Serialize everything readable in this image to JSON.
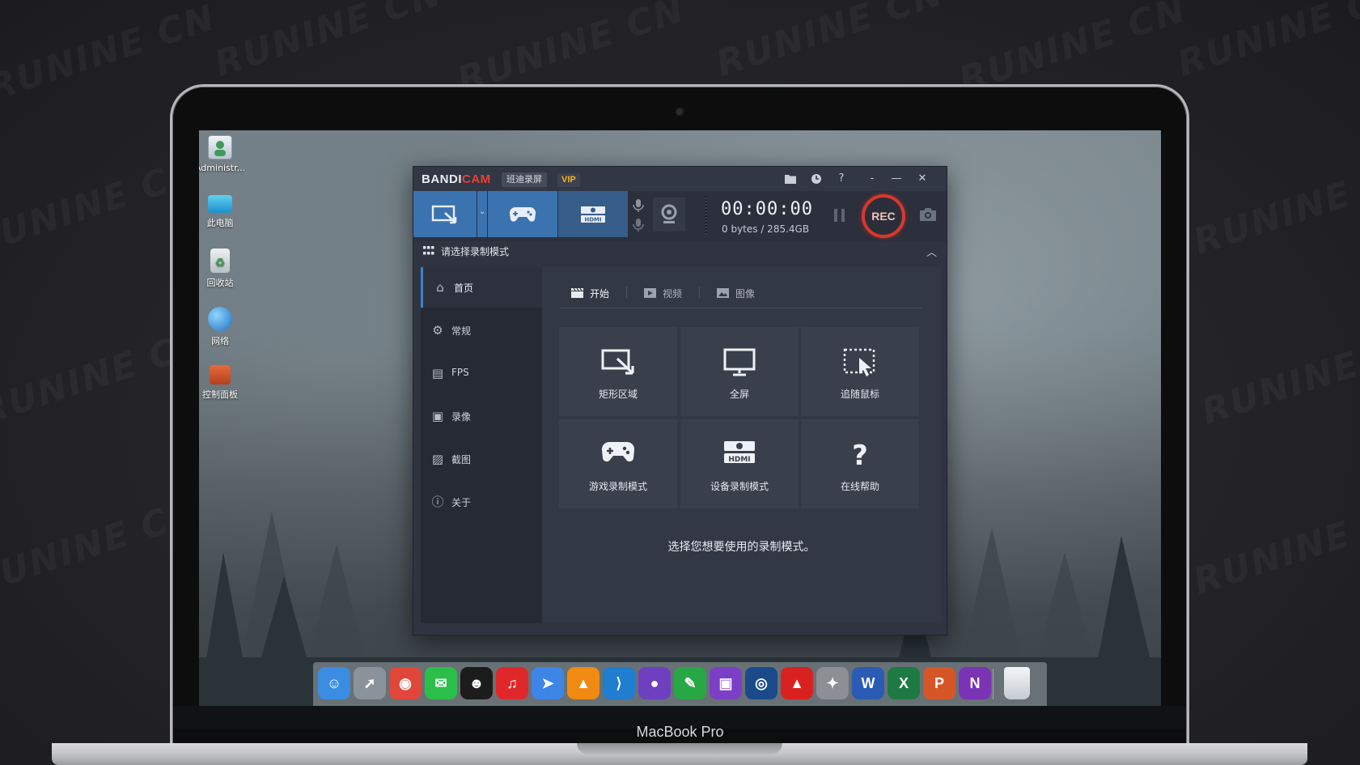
{
  "desktop": {
    "icons": [
      {
        "label": "Administr...",
        "icon": "user-folder-icon"
      },
      {
        "label": "此电脑",
        "icon": "computer-icon"
      },
      {
        "label": "回收站",
        "icon": "recycle-bin-icon"
      },
      {
        "label": "网络",
        "icon": "network-globe-icon"
      },
      {
        "label": "控制面板",
        "icon": "control-panel-icon"
      }
    ]
  },
  "bandicam": {
    "logo_main": "BANDI",
    "logo_accent": "CAM",
    "subtitle": "班迪录屏",
    "vip": "VIP",
    "titlebar_buttons": {
      "folder": "folder-icon",
      "history": "clock-icon",
      "help": "?",
      "minimize_small": "-",
      "minimize": "—",
      "close": "✕"
    },
    "timer": "00:00:00",
    "size_info": "0 bytes / 285.4GB",
    "rec_label": "REC",
    "mode_bar_title": "请选择录制模式",
    "sidebar": [
      {
        "label": "首页",
        "icon": "home-icon"
      },
      {
        "label": "常规",
        "icon": "gear-icon"
      },
      {
        "label": "FPS",
        "icon": "fps-icon"
      },
      {
        "label": "录像",
        "icon": "video-settings-icon"
      },
      {
        "label": "截图",
        "icon": "image-settings-icon"
      },
      {
        "label": "关于",
        "icon": "info-icon"
      }
    ],
    "tabs": [
      {
        "label": "开始",
        "icon": "clapper-icon"
      },
      {
        "label": "视频",
        "icon": "play-icon"
      },
      {
        "label": "图像",
        "icon": "picture-icon"
      }
    ],
    "tiles": [
      {
        "label": "矩形区域",
        "icon": "rectangle-area-icon"
      },
      {
        "label": "全屏",
        "icon": "monitor-icon"
      },
      {
        "label": "追随鼠标",
        "icon": "follow-mouse-icon"
      },
      {
        "label": "游戏录制模式",
        "icon": "gamepad-icon"
      },
      {
        "label": "设备录制模式",
        "icon": "hdmi-icon"
      },
      {
        "label": "在线帮助",
        "icon": "question-icon"
      }
    ],
    "hint": "选择您想要使用的录制模式。"
  },
  "dock": {
    "apps": [
      {
        "name": "finder-icon",
        "color": "#3a8de0",
        "glyph": "☺"
      },
      {
        "name": "launchpad-icon",
        "color": "#8a939c",
        "glyph": "➚"
      },
      {
        "name": "chrome-icon",
        "color": "#e0463a",
        "glyph": "◉"
      },
      {
        "name": "wechat-icon",
        "color": "#2bbf4a",
        "glyph": "✉"
      },
      {
        "name": "qq-icon",
        "color": "#1c1c1c",
        "glyph": "☻"
      },
      {
        "name": "netease-music-icon",
        "color": "#e0282b",
        "glyph": "♫"
      },
      {
        "name": "paper-plane-icon",
        "color": "#3d86e8",
        "glyph": "➤"
      },
      {
        "name": "vlc-icon",
        "color": "#f08a12",
        "glyph": "▲"
      },
      {
        "name": "vscode-icon",
        "color": "#1f7ed0",
        "glyph": "⟩"
      },
      {
        "name": "github-icon",
        "color": "#6e3fbf",
        "glyph": "●"
      },
      {
        "name": "evernote-icon",
        "color": "#27a845",
        "glyph": "✎"
      },
      {
        "name": "twitch-icon",
        "color": "#7b3fc7",
        "glyph": "▣"
      },
      {
        "name": "steam-icon",
        "color": "#1a4a8a",
        "glyph": "◎"
      },
      {
        "name": "adobe-icon",
        "color": "#d9221f",
        "glyph": "▲"
      },
      {
        "name": "rhino-icon",
        "color": "#8c8f94",
        "glyph": "✦"
      },
      {
        "name": "word-icon",
        "color": "#2a5bb5",
        "glyph": "W"
      },
      {
        "name": "excel-icon",
        "color": "#1e7a43",
        "glyph": "X"
      },
      {
        "name": "powerpoint-icon",
        "color": "#d65627",
        "glyph": "P"
      },
      {
        "name": "onenote-icon",
        "color": "#7b33b5",
        "glyph": "N"
      },
      {
        "name": "trash-icon",
        "color": "#dfe3e8",
        "glyph": ""
      }
    ]
  },
  "device_label": "MacBook Pro"
}
